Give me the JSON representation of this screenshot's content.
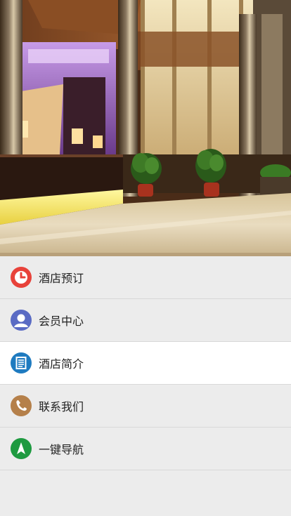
{
  "hero": {
    "image": "hotel-lobby-photo"
  },
  "menu": {
    "items": [
      {
        "label": "酒店预订",
        "icon": "clock-icon",
        "color": "#e8423a",
        "active": false
      },
      {
        "label": "会员中心",
        "icon": "user-icon",
        "color": "#5a6bc4",
        "active": false
      },
      {
        "label": "酒店简介",
        "icon": "document-icon",
        "color": "#1f7bc0",
        "active": true
      },
      {
        "label": "联系我们",
        "icon": "phone-icon",
        "color": "#b5804a",
        "active": false
      },
      {
        "label": "一键导航",
        "icon": "navigation-arrow-icon",
        "color": "#1e9a40",
        "active": false
      }
    ]
  }
}
